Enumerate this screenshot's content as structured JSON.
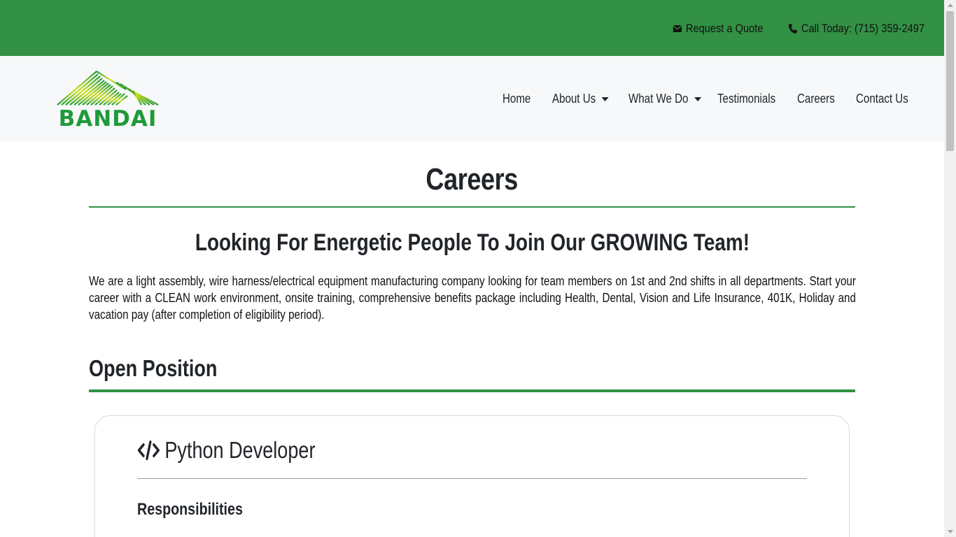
{
  "colors": {
    "brand_green": "#329145",
    "navbar_bg": "#f7f8f9",
    "logo_green": "#1f9a3a",
    "logo_yellow": "#d4e21d"
  },
  "topbar": {
    "quote": {
      "icon": "envelope-icon",
      "label": "Request a Quote"
    },
    "phone": {
      "icon": "phone-icon",
      "label": "Call Today: (715) 359-2497"
    }
  },
  "logo": {
    "text": "BANDAI"
  },
  "nav": {
    "items": [
      {
        "label": "Home"
      },
      {
        "label": "About Us",
        "dropdown": true
      },
      {
        "label": "What We Do",
        "dropdown": true
      },
      {
        "label": "Testimonials"
      },
      {
        "label": "Careers"
      },
      {
        "label": "Contact Us"
      }
    ]
  },
  "main": {
    "title": "Careers",
    "subtitle": "Looking For Energetic People To Join Our GROWING Team!",
    "intro": "We are a light assembly, wire harness/electrical equipment manufacturing company looking for team members on 1st and 2nd shifts in all departments. Start your career with a CLEAN work environment, onsite training, comprehensive benefits package including Health, Dental, Vision and Life Insurance, 401K, Holiday and vacation pay (after completion of eligibility period).",
    "section_title": "Open Position",
    "job": {
      "icon": "code-icon",
      "title": "Python Developer",
      "responsibilities_heading": "Responsibilities"
    }
  }
}
